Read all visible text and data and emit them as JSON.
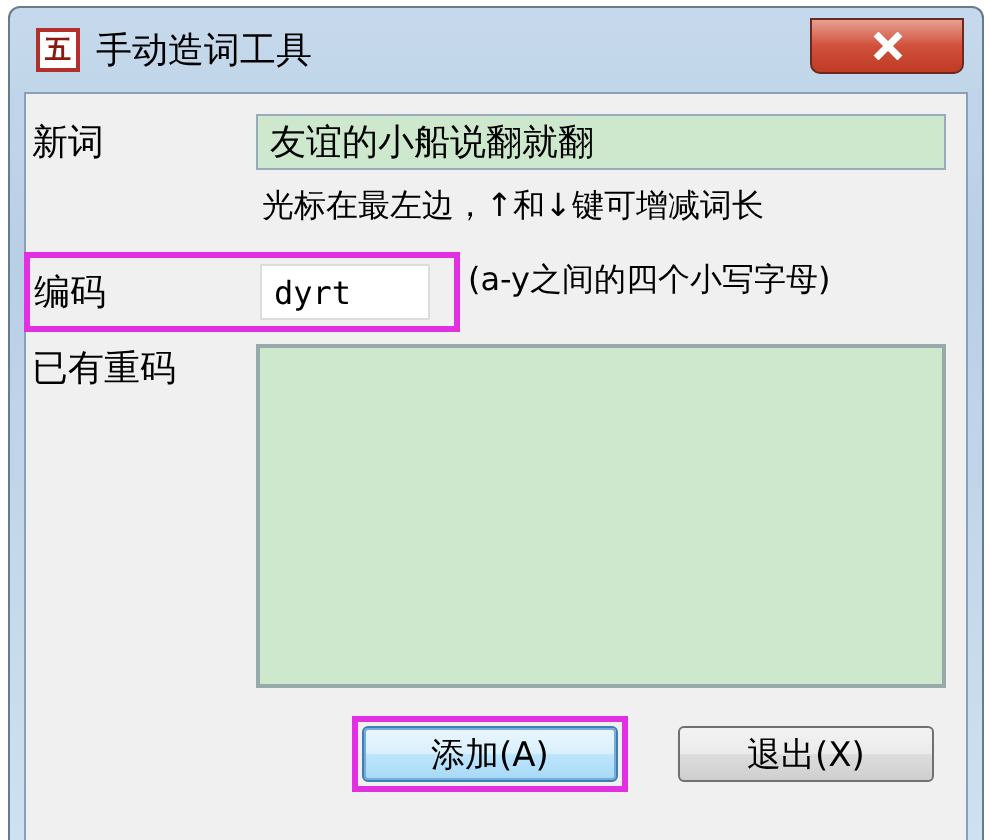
{
  "window": {
    "app_icon": "五",
    "title": "手动造词工具"
  },
  "new_word": {
    "label": "新词",
    "value": "友谊的小船说翻就翻",
    "hint": "光标在最左边，↑和↓键可增减词长"
  },
  "code": {
    "label": "编码",
    "value": "dyrt",
    "hint": "(a-y之间的四个小写字母)",
    "highlighted": true
  },
  "duplicates": {
    "label": "已有重码"
  },
  "buttons": [
    {
      "label": "添加(A)",
      "default": true,
      "highlighted": true
    },
    {
      "label": "退出(X)",
      "default": false,
      "highlighted": false
    }
  ]
}
